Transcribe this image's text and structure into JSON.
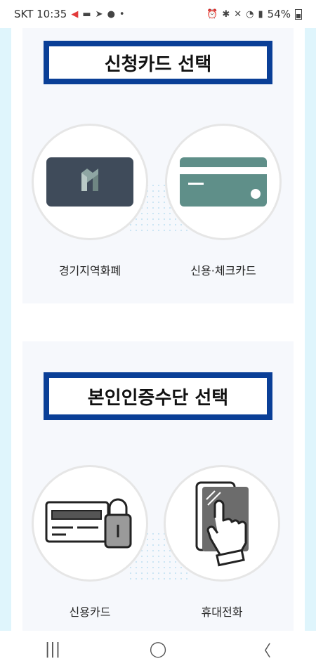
{
  "status_bar": {
    "carrier_time": "SKT 10:35",
    "battery": "54%"
  },
  "card_section": {
    "title": "신청카드 선택",
    "options": [
      {
        "label": "경기지역화폐",
        "icon": "local-currency-card-icon"
      },
      {
        "label": "신용·체크카드",
        "icon": "credit-card-icon"
      }
    ]
  },
  "auth_section": {
    "title": "본인인증수단 선택",
    "options": [
      {
        "label": "신용카드",
        "icon": "card-lock-icon"
      },
      {
        "label": "휴대전화",
        "icon": "phone-touch-icon"
      }
    ]
  },
  "nav_bar": {
    "recent": "|||",
    "home": "◯",
    "back": "〈"
  },
  "colors": {
    "title_border": "#0a3f97",
    "page_bg": "#e1f4fb",
    "section_bg": "#f6f8fc",
    "gm_card": "#3f4b5a",
    "credit_card": "#5f8f89"
  }
}
